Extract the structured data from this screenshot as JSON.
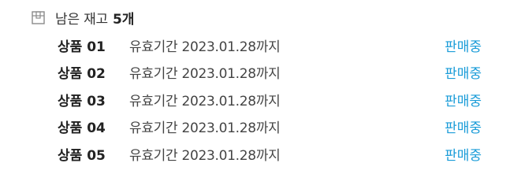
{
  "stock": {
    "icon": "box-icon",
    "label": "남은 재고",
    "count": "5개"
  },
  "products": [
    {
      "name": "상품 01",
      "expiry": "유효기간 2023.01.28까지",
      "status": "판매중"
    },
    {
      "name": "상품 02",
      "expiry": "유효기간 2023.01.28까지",
      "status": "판매중"
    },
    {
      "name": "상품 03",
      "expiry": "유효기간 2023.01.28까지",
      "status": "판매중"
    },
    {
      "name": "상품 04",
      "expiry": "유효기간 2023.01.28까지",
      "status": "판매중"
    },
    {
      "name": "상품 05",
      "expiry": "유효기간 2023.01.28까지",
      "status": "판매중"
    }
  ],
  "colors": {
    "status_accent": "#1a9cd8",
    "icon_gray": "#8a8a8a"
  }
}
